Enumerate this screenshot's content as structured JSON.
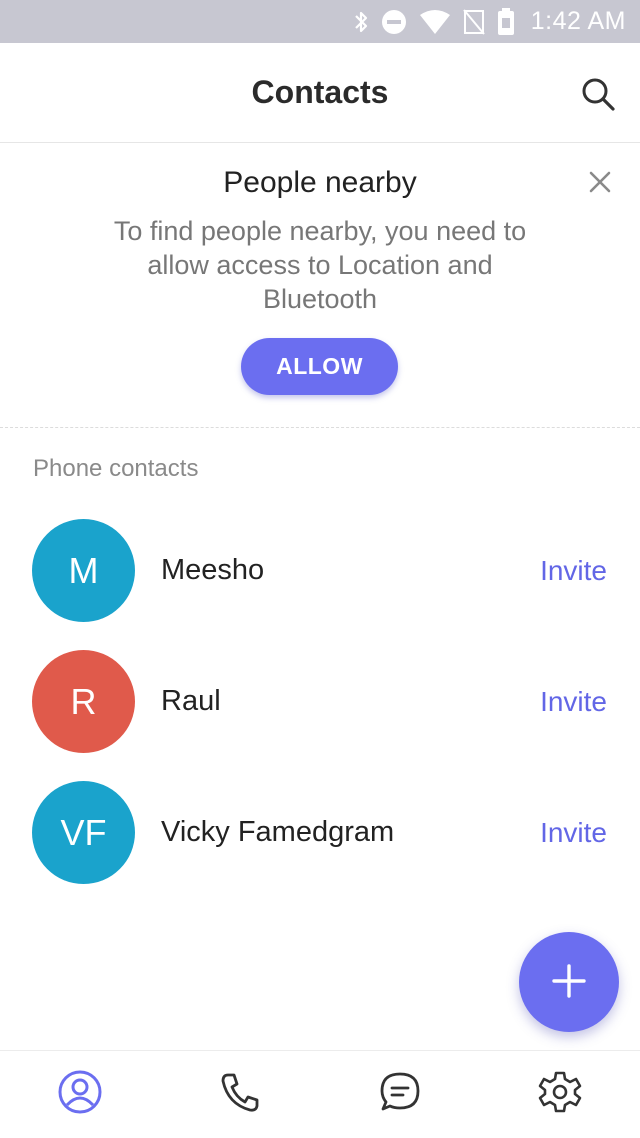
{
  "status_bar": {
    "time": "1:42 AM",
    "icons": [
      "bluetooth-icon",
      "do-not-disturb-icon",
      "wifi-icon",
      "no-sim-icon",
      "battery-icon"
    ]
  },
  "app_bar": {
    "title": "Contacts",
    "search_icon": "search-icon"
  },
  "nearby": {
    "title": "People nearby",
    "description": "To find people nearby, you need to allow access to Location and Bluetooth",
    "allow_label": "ALLOW",
    "close_icon": "close-icon"
  },
  "contacts": {
    "section_title": "Phone contacts",
    "items": [
      {
        "initials": "M",
        "name": "Meesho",
        "action": "Invite",
        "color": "#1aa3cc"
      },
      {
        "initials": "R",
        "name": "Raul",
        "action": "Invite",
        "color": "#e05a4b"
      },
      {
        "initials": "VF",
        "name": "Vicky Famedgram",
        "action": "Invite",
        "color": "#1aa3cc"
      }
    ]
  },
  "fab": {
    "icon": "plus-icon"
  },
  "bottom_nav": {
    "items": [
      {
        "icon": "contacts-icon",
        "active": true
      },
      {
        "icon": "phone-icon",
        "active": false
      },
      {
        "icon": "chat-icon",
        "active": false
      },
      {
        "icon": "gear-icon",
        "active": false
      }
    ]
  },
  "colors": {
    "accent": "#6b6ef0",
    "link": "#6266e6",
    "status_bar": "#c7c7d1"
  }
}
